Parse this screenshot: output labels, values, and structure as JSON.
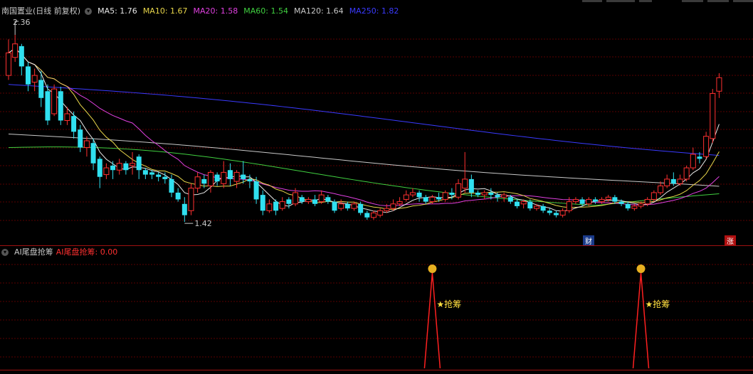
{
  "main_header": {
    "title": "南国置业(日线 前复权)",
    "ma_labels": [
      {
        "text": "MA5: 1.76",
        "color": "#e8e8e8"
      },
      {
        "text": "MA10: 1.67",
        "color": "#e8d64a"
      },
      {
        "text": "MA20: 1.58",
        "color": "#e040e0"
      },
      {
        "text": "MA60: 1.54",
        "color": "#40d040"
      },
      {
        "text": "MA120: 1.64",
        "color": "#c8c8c8"
      },
      {
        "text": "MA250: 1.82",
        "color": "#3a3aff"
      }
    ]
  },
  "sub_header": {
    "title": "AI尾盘抢筹",
    "value_label": "AI尾盘抢筹: 0.00",
    "value_color": "#ff3030"
  },
  "annotations": {
    "high": "2.36",
    "low": "1.42",
    "signal": "★抢筹",
    "caibadge": "财",
    "zhangbadge": "涨"
  },
  "colors": {
    "up": "#ff3030",
    "down": "#30e0f0",
    "grid": "#5a0000",
    "text": "#c8c8c8"
  },
  "chart_data": {
    "type": "candlestick",
    "ylim": [
      1.42,
      2.36
    ],
    "candles": [
      [
        2.12,
        2.22,
        2.28,
        2.1
      ],
      [
        2.2,
        2.26,
        2.3,
        2.18
      ],
      [
        2.25,
        2.16,
        2.26,
        2.12
      ],
      [
        2.16,
        2.08,
        2.18,
        2.05
      ],
      [
        2.09,
        2.12,
        2.15,
        2.05
      ],
      [
        2.1,
        2.02,
        2.14,
        1.98
      ],
      [
        2.05,
        1.92,
        2.08,
        1.9
      ],
      [
        1.95,
        2.06,
        2.08,
        1.94
      ],
      [
        2.05,
        1.92,
        2.07,
        1.9
      ],
      [
        1.92,
        1.95,
        1.98,
        1.9
      ],
      [
        1.94,
        1.87,
        1.96,
        1.84
      ],
      [
        1.88,
        1.8,
        1.9,
        1.78
      ],
      [
        1.8,
        1.83,
        1.85,
        1.76
      ],
      [
        1.82,
        1.73,
        1.84,
        1.7
      ],
      [
        1.75,
        1.67,
        1.76,
        1.62
      ],
      [
        1.68,
        1.71,
        1.73,
        1.66
      ],
      [
        1.72,
        1.7,
        1.74,
        1.66
      ],
      [
        1.7,
        1.73,
        1.75,
        1.68
      ],
      [
        1.73,
        1.7,
        1.74,
        1.68
      ],
      [
        1.72,
        1.73,
        1.78,
        1.68
      ],
      [
        1.76,
        1.7,
        1.77,
        1.66
      ],
      [
        1.7,
        1.68,
        1.71,
        1.66
      ],
      [
        1.69,
        1.68,
        1.7,
        1.66
      ],
      [
        1.68,
        1.67,
        1.69,
        1.65
      ],
      [
        1.67,
        1.66,
        1.69,
        1.64
      ],
      [
        1.66,
        1.6,
        1.68,
        1.58
      ],
      [
        1.6,
        1.57,
        1.62,
        1.56
      ],
      [
        1.55,
        1.5,
        1.58,
        1.47
      ],
      [
        1.52,
        1.62,
        1.64,
        1.5
      ],
      [
        1.62,
        1.67,
        1.69,
        1.6
      ],
      [
        1.66,
        1.64,
        1.68,
        1.62
      ],
      [
        1.63,
        1.69,
        1.7,
        1.6
      ],
      [
        1.68,
        1.65,
        1.69,
        1.63
      ],
      [
        1.64,
        1.69,
        1.74,
        1.62
      ],
      [
        1.7,
        1.66,
        1.73,
        1.63
      ],
      [
        1.65,
        1.69,
        1.7,
        1.62
      ],
      [
        1.68,
        1.66,
        1.74,
        1.64
      ],
      [
        1.66,
        1.65,
        1.68,
        1.62
      ],
      [
        1.65,
        1.57,
        1.67,
        1.55
      ],
      [
        1.59,
        1.52,
        1.61,
        1.5
      ],
      [
        1.52,
        1.55,
        1.57,
        1.51
      ],
      [
        1.56,
        1.52,
        1.57,
        1.5
      ],
      [
        1.53,
        1.56,
        1.58,
        1.52
      ],
      [
        1.57,
        1.55,
        1.58,
        1.53
      ],
      [
        1.55,
        1.6,
        1.62,
        1.54
      ],
      [
        1.58,
        1.56,
        1.59,
        1.55
      ],
      [
        1.56,
        1.57,
        1.58,
        1.55
      ],
      [
        1.57,
        1.55,
        1.59,
        1.54
      ],
      [
        1.56,
        1.59,
        1.61,
        1.55
      ],
      [
        1.58,
        1.56,
        1.59,
        1.55
      ],
      [
        1.56,
        1.52,
        1.57,
        1.51
      ],
      [
        1.53,
        1.55,
        1.57,
        1.52
      ],
      [
        1.55,
        1.53,
        1.56,
        1.52
      ],
      [
        1.53,
        1.55,
        1.56,
        1.52
      ],
      [
        1.55,
        1.51,
        1.56,
        1.5
      ],
      [
        1.51,
        1.49,
        1.52,
        1.48
      ],
      [
        1.49,
        1.51,
        1.52,
        1.48
      ],
      [
        1.5,
        1.52,
        1.53,
        1.49
      ],
      [
        1.52,
        1.53,
        1.55,
        1.51
      ],
      [
        1.53,
        1.55,
        1.57,
        1.52
      ],
      [
        1.55,
        1.56,
        1.58,
        1.54
      ],
      [
        1.57,
        1.59,
        1.61,
        1.56
      ],
      [
        1.59,
        1.6,
        1.62,
        1.58
      ],
      [
        1.6,
        1.58,
        1.61,
        1.56
      ],
      [
        1.58,
        1.56,
        1.59,
        1.55
      ],
      [
        1.56,
        1.58,
        1.59,
        1.55
      ],
      [
        1.58,
        1.57,
        1.6,
        1.56
      ],
      [
        1.57,
        1.6,
        1.61,
        1.56
      ],
      [
        1.6,
        1.59,
        1.62,
        1.57
      ],
      [
        1.58,
        1.64,
        1.66,
        1.57
      ],
      [
        1.62,
        1.66,
        1.78,
        1.6
      ],
      [
        1.66,
        1.6,
        1.68,
        1.58
      ],
      [
        1.6,
        1.59,
        1.61,
        1.58
      ],
      [
        1.59,
        1.6,
        1.61,
        1.57
      ],
      [
        1.6,
        1.59,
        1.62,
        1.57
      ],
      [
        1.59,
        1.58,
        1.6,
        1.56
      ],
      [
        1.58,
        1.59,
        1.6,
        1.56
      ],
      [
        1.58,
        1.56,
        1.59,
        1.55
      ],
      [
        1.56,
        1.54,
        1.57,
        1.53
      ],
      [
        1.55,
        1.56,
        1.57,
        1.53
      ],
      [
        1.56,
        1.53,
        1.57,
        1.52
      ],
      [
        1.53,
        1.54,
        1.55,
        1.52
      ],
      [
        1.54,
        1.52,
        1.55,
        1.51
      ],
      [
        1.52,
        1.51,
        1.53,
        1.5
      ],
      [
        1.51,
        1.5,
        1.52,
        1.49
      ],
      [
        1.5,
        1.52,
        1.53,
        1.49
      ],
      [
        1.52,
        1.56,
        1.58,
        1.51
      ],
      [
        1.56,
        1.57,
        1.58,
        1.55
      ],
      [
        1.57,
        1.55,
        1.58,
        1.54
      ],
      [
        1.55,
        1.57,
        1.58,
        1.54
      ],
      [
        1.57,
        1.56,
        1.58,
        1.55
      ],
      [
        1.56,
        1.57,
        1.58,
        1.55
      ],
      [
        1.57,
        1.58,
        1.59,
        1.56
      ],
      [
        1.58,
        1.56,
        1.59,
        1.55
      ],
      [
        1.56,
        1.55,
        1.57,
        1.54
      ],
      [
        1.55,
        1.53,
        1.56,
        1.52
      ],
      [
        1.53,
        1.54,
        1.55,
        1.52
      ],
      [
        1.54,
        1.55,
        1.56,
        1.53
      ],
      [
        1.55,
        1.57,
        1.58,
        1.54
      ],
      [
        1.57,
        1.6,
        1.61,
        1.56
      ],
      [
        1.6,
        1.63,
        1.65,
        1.59
      ],
      [
        1.63,
        1.66,
        1.68,
        1.62
      ],
      [
        1.66,
        1.64,
        1.69,
        1.63
      ],
      [
        1.64,
        1.66,
        1.68,
        1.63
      ],
      [
        1.66,
        1.71,
        1.72,
        1.65
      ],
      [
        1.71,
        1.77,
        1.8,
        1.7
      ],
      [
        1.76,
        1.75,
        1.78,
        1.73
      ],
      [
        1.76,
        1.85,
        1.87,
        1.75
      ],
      [
        1.84,
        2.04,
        2.06,
        1.82
      ],
      [
        2.05,
        2.11,
        2.13,
        2.02
      ]
    ]
  },
  "sub_chart": {
    "signals_at": [
      65,
      97
    ]
  }
}
